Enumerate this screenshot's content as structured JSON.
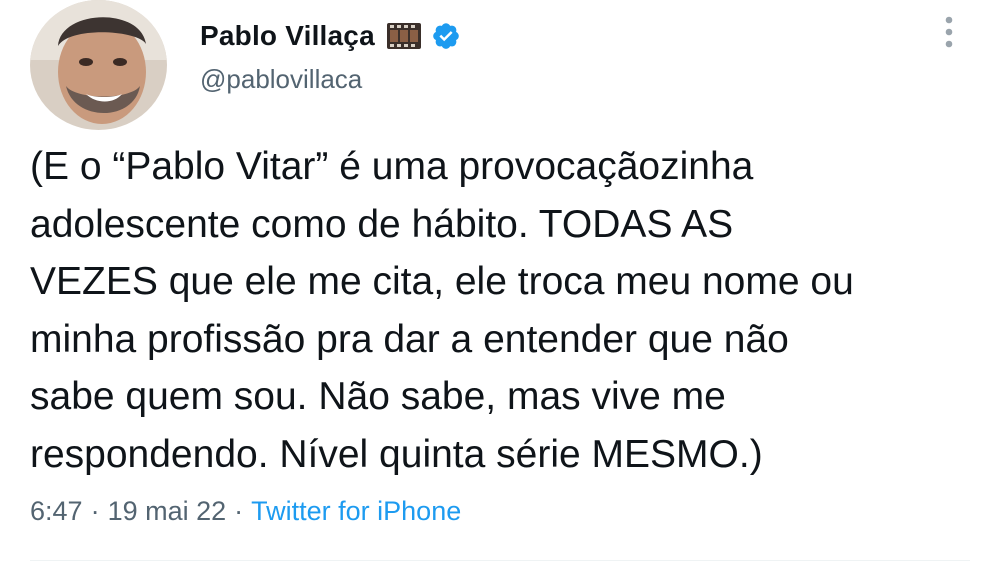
{
  "author": {
    "display_name": "Pablo Villaça",
    "handle": "@pablovillaca",
    "avatar_icon": "user-avatar-photo",
    "badge_icons": [
      "film-frames-icon",
      "verified-badge-icon"
    ],
    "verified_color": "#1d9bf0"
  },
  "tweet": {
    "text": "(E o “Pablo Vitar” é uma provocaçãozinha\nadolescente como de hábito. TODAS AS\nVEZES que ele me cita, ele troca meu nome ou\nminha profissão pra dar a entender que não\nsabe quem sou. Não sabe, mas vive me\nrespondendo. Nível quinta série MESMO.)",
    "time": "6:47",
    "date": "19 mai 22",
    "separator": "·",
    "source": "Twitter for iPhone"
  },
  "menu": {
    "icon": "more-vertical-icon"
  },
  "colors": {
    "text": "#0f1419",
    "secondary": "#536471",
    "link": "#1d9bf0"
  }
}
